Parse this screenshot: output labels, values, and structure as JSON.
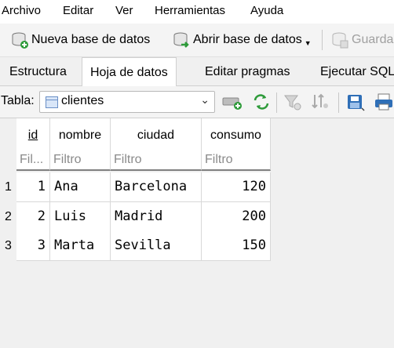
{
  "menubar": {
    "items": [
      "Archivo",
      "Editar",
      "Ver",
      "Herramientas",
      "Ayuda"
    ]
  },
  "toolbar": {
    "new_db": "Nueva base de datos",
    "open_db": "Abrir base de datos",
    "save": "Guarda"
  },
  "tabs": [
    {
      "label": "Estructura",
      "active": false
    },
    {
      "label": "Hoja de datos",
      "active": true
    },
    {
      "label": "Editar pragmas",
      "active": false
    },
    {
      "label": "Ejecutar SQL",
      "active": false
    }
  ],
  "table_selector": {
    "label": "Tabla:",
    "value": "clientes"
  },
  "grid": {
    "columns": [
      {
        "name": "id",
        "filter": "Fil..."
      },
      {
        "name": "nombre",
        "filter": "Filtro"
      },
      {
        "name": "ciudad",
        "filter": "Filtro"
      },
      {
        "name": "consumo",
        "filter": "Filtro"
      }
    ],
    "rows": [
      {
        "num": "1",
        "cells": [
          "1",
          "Ana",
          "Barcelona",
          "120"
        ]
      },
      {
        "num": "2",
        "cells": [
          "2",
          "Luis",
          "Madrid",
          "200"
        ]
      },
      {
        "num": "3",
        "cells": [
          "3",
          "Marta",
          "Sevilla",
          "150"
        ]
      }
    ]
  },
  "colors": {
    "accent_green": "#2e9b3a",
    "accent_blue": "#2f6fb7",
    "grid_line": "#d8d8d8"
  }
}
